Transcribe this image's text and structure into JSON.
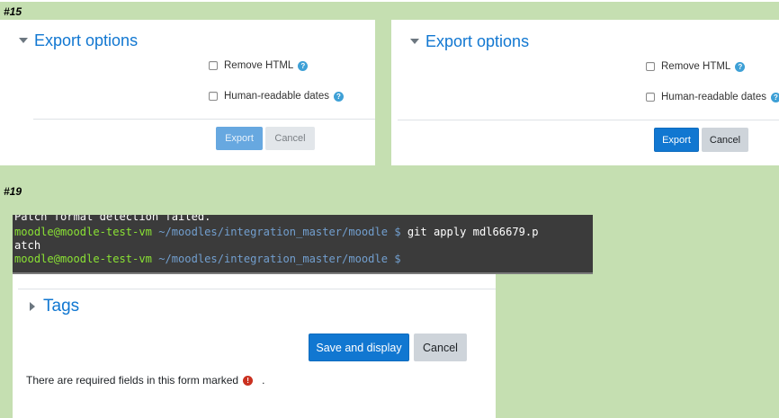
{
  "labels": {
    "issue_a": "#15",
    "issue_b": "#19"
  },
  "left_panel": {
    "section_title": "Export options",
    "checkboxes": [
      {
        "label": "Remove HTML"
      },
      {
        "label": "Human-readable dates"
      }
    ],
    "export_label": "Export",
    "cancel_label": "Cancel",
    "state": "disabled"
  },
  "right_panel": {
    "section_title": "Export options",
    "checkboxes": [
      {
        "label": "Remove HTML"
      },
      {
        "label": "Human-readable dates"
      }
    ],
    "export_label": "Export",
    "cancel_label": "Cancel",
    "state": "enabled"
  },
  "terminal": {
    "line1": "Patch format detection failed.",
    "prompt_user": "moodle@moodle-test-vm",
    "prompt_path": "~/moodles/integration_master/moodle",
    "prompt_symbol": "$",
    "command_part1": "git apply mdl66679.p",
    "command_part2": "atch"
  },
  "bottom_panel": {
    "section_title": "Tags",
    "save_label": "Save and display",
    "cancel_label": "Cancel",
    "required_text": "There are required fields in this form marked",
    "required_suffix": ".",
    "required_icon": "!"
  },
  "icons": {
    "help": "?"
  },
  "colors": {
    "background": "#c5dfb1",
    "primary": "#1177d1",
    "terminal_bg": "#3b3b3b",
    "prompt_user": "#8ae234",
    "prompt_path": "#729fcf"
  }
}
